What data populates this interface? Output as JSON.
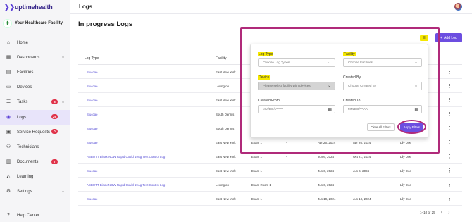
{
  "brand": {
    "name": "uptimehealth",
    "accent": "#6c4ee0",
    "highlight": "#f5e700",
    "annotation": "#b02a7a"
  },
  "facility": {
    "name": "Your Healthcare Facility"
  },
  "sidebar": {
    "items": [
      {
        "label": "Home",
        "icon": "home-icon",
        "glyph": "⌂"
      },
      {
        "label": "Dashboards",
        "icon": "dashboard-icon",
        "glyph": "▦",
        "chevron": true
      },
      {
        "label": "Facilities",
        "icon": "building-icon",
        "glyph": "▤"
      },
      {
        "label": "Devices",
        "icon": "device-icon",
        "glyph": "▭"
      },
      {
        "label": "Tasks",
        "icon": "tasks-icon",
        "glyph": "☰",
        "badge": "8",
        "chevron": true
      },
      {
        "label": "Logs",
        "icon": "logs-icon",
        "glyph": "◉",
        "badge": "26",
        "active": true
      },
      {
        "label": "Service Requests",
        "icon": "service-icon",
        "glyph": "▣",
        "badge": "0"
      },
      {
        "label": "Technicians",
        "icon": "people-icon",
        "glyph": "⚇"
      },
      {
        "label": "Documents",
        "icon": "document-icon",
        "glyph": "▥",
        "badge": "7"
      },
      {
        "label": "Learning",
        "icon": "learning-icon",
        "glyph": "◭"
      },
      {
        "label": "Settings",
        "icon": "gear-icon",
        "glyph": "⚙",
        "chevron": true
      }
    ],
    "help": "Help Center"
  },
  "header": {
    "page_label": "Logs"
  },
  "main": {
    "title": "In progress Logs",
    "add_button": "Add Log",
    "columns": [
      "Log Type",
      "Facility"
    ],
    "rows": [
      {
        "type": "Sluccae",
        "facility": "East New York"
      },
      {
        "type": "Sluccae",
        "facility": "Lexington"
      },
      {
        "type": "Sluccae",
        "facility": "East New York"
      },
      {
        "type": "Sluccae",
        "facility": "South Dennis"
      },
      {
        "type": "Sluccae",
        "facility": "South Dennis"
      },
      {
        "type": "Sluccae",
        "facility": "East New York",
        "c3": "Exam 1",
        "c4": "-",
        "c5": "Apr 26, 2024",
        "c6": "Apr 26, 2024",
        "c7": "Lily Doe"
      },
      {
        "type": "ABBOTT Binax NOW Rapid Covid 19Ag Test Control Log",
        "facility": "East New York",
        "c3": "Exam 1",
        "c4": "-",
        "c5": "Jun 6, 2024",
        "c6": "Oct 21, 2024",
        "c7": "Lily Doe"
      },
      {
        "type": "Sluccae",
        "facility": "East New York",
        "c3": "Exam 1",
        "c4": "-",
        "c5": "Jun 6, 2024",
        "c6": "Jun 6, 2024",
        "c7": "Lily Doe"
      },
      {
        "type": "ABBOTT Binax NOW Rapid Covid 19Ag Test Control Log",
        "facility": "Lexington",
        "c3": "Exam Room 1",
        "c4": "-",
        "c5": "Jun 6, 2024",
        "c6": "-",
        "c7": "Lily Doe"
      },
      {
        "type": "Sluccae",
        "facility": "East New York",
        "c3": "Exam 1",
        "c4": "-",
        "c5": "Jun 19, 2024",
        "c6": "Jun 19, 2024",
        "c7": "Lily Doe"
      }
    ],
    "pagination": "1–10 of 25"
  },
  "filters": {
    "log_type": {
      "label": "Log Type",
      "placeholder": "Choose Log Types"
    },
    "facility": {
      "label": "Facility",
      "placeholder": "Choose Facilities"
    },
    "device": {
      "label": "Device",
      "placeholder": "Please select facility with devices"
    },
    "created_by": {
      "label": "Created By",
      "placeholder": "Choose Created By"
    },
    "created_from": {
      "label": "Created From",
      "placeholder": "MM/DD/YYYY"
    },
    "created_to": {
      "label": "Created To",
      "placeholder": "MM/DD/YYYY"
    },
    "clear_label": "Clear All Filters",
    "apply_label": "Apply Filters"
  }
}
